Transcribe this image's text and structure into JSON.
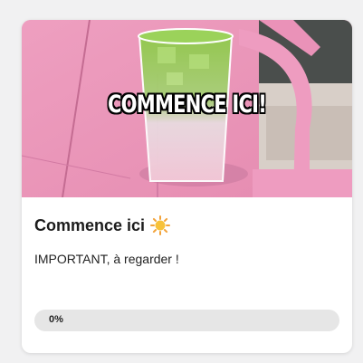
{
  "card": {
    "image_overlay_text": "COMMENCE ICI!",
    "title": "Commence ici",
    "title_icon": "sun-icon",
    "subtitle": "IMPORTANT, à regarder !",
    "progress": {
      "value": 0,
      "label": "0%"
    }
  },
  "colors": {
    "page_background": "#f1f1f2",
    "card_background": "#ffffff",
    "progress_track": "#e6e6e6",
    "image_pink": "#e995b6",
    "drink_green": "#7fbf3c"
  }
}
